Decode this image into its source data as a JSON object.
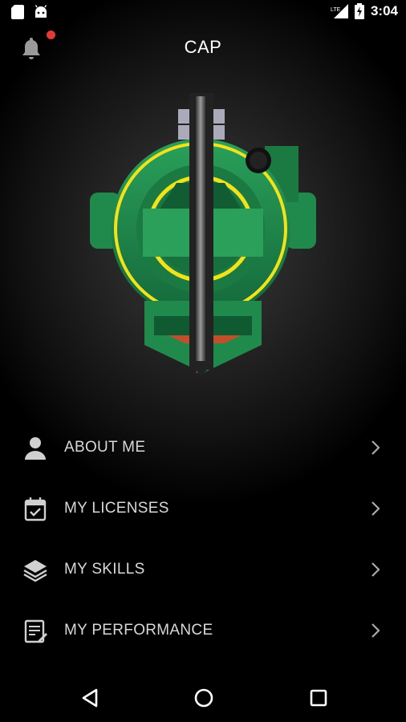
{
  "status_bar": {
    "time": "3:04",
    "left_icons": [
      "sd-card-icon",
      "android-icon"
    ],
    "right_icons": [
      "lte-signal-icon",
      "battery-charging-icon"
    ],
    "lte_label": "LTE"
  },
  "header": {
    "title": "CAP",
    "notification_icon": "bell-icon",
    "has_unread": true
  },
  "hero": {
    "icon": "gearbox-emblem-icon"
  },
  "menu": {
    "items": [
      {
        "label": "ABOUT ME",
        "icon": "person-icon"
      },
      {
        "label": "MY LICENSES",
        "icon": "calendar-check-icon"
      },
      {
        "label": "MY SKILLS",
        "icon": "layers-icon"
      },
      {
        "label": "MY PERFORMANCE",
        "icon": "report-icon"
      }
    ]
  },
  "nav_bar": {
    "buttons": [
      "back-icon",
      "home-icon",
      "recents-icon"
    ]
  },
  "colors": {
    "accent_green": "#1f8a4c",
    "accent_yellow": "#f2e21a",
    "notification_dot": "#e53935",
    "text_light": "#d8d8d8"
  }
}
